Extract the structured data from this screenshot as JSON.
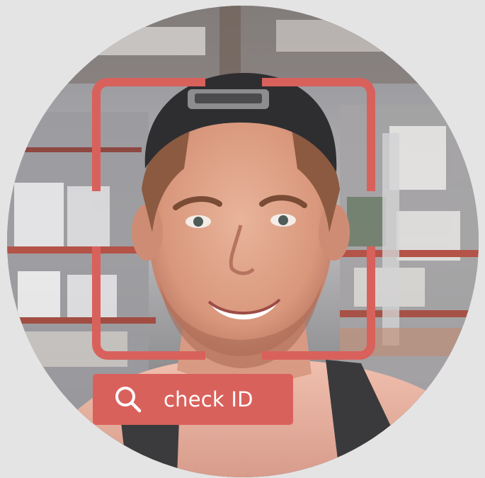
{
  "photo": {
    "subject": "smiling-man-selfie",
    "background": "warehouse-shelves"
  },
  "face_frame": {
    "color": "#d9615c"
  },
  "action_button": {
    "label": "check ID",
    "icon": "search-icon",
    "background_color": "#d9615c",
    "text_color": "#ffffff"
  },
  "page": {
    "background_color": "#e4e4e4"
  }
}
